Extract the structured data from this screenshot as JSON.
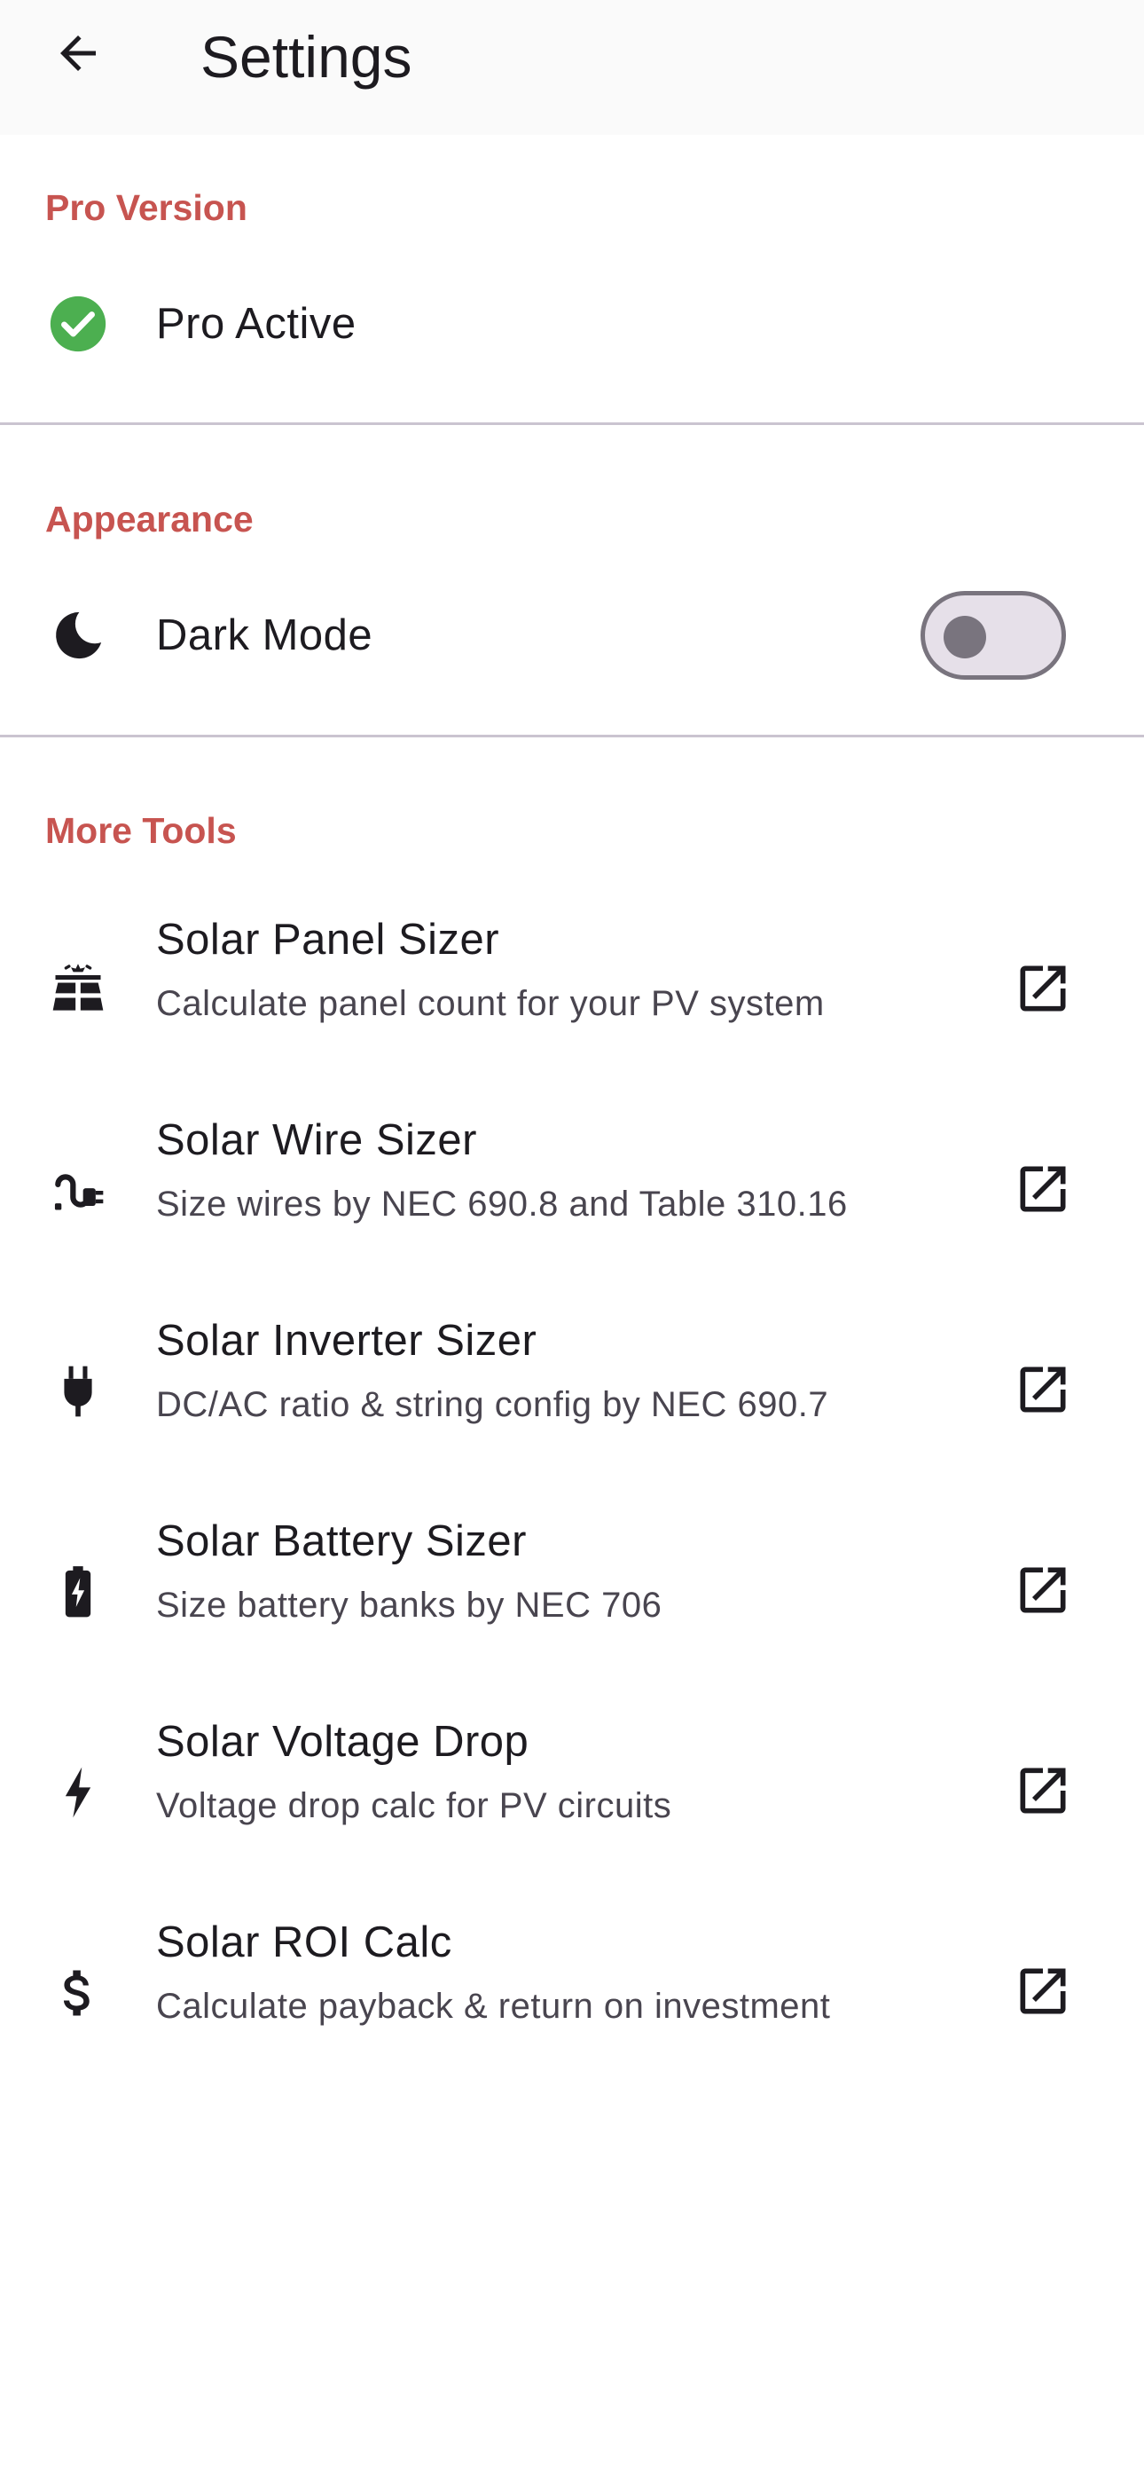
{
  "app_bar": {
    "title": "Settings"
  },
  "sections": {
    "pro": {
      "header": "Pro Version",
      "item_label": "Pro Active"
    },
    "appearance": {
      "header": "Appearance",
      "item_label": "Dark Mode",
      "toggle_on": false
    },
    "tools": {
      "header": "More Tools",
      "items": [
        {
          "title": "Solar Panel Sizer",
          "subtitle": "Calculate panel count for your PV system",
          "icon": "solar-panel-icon"
        },
        {
          "title": "Solar Wire Sizer",
          "subtitle": "Size wires by NEC 690.8 and Table 310.16",
          "icon": "cable-plug-icon"
        },
        {
          "title": "Solar Inverter Sizer",
          "subtitle": "DC/AC ratio & string config by NEC 690.7",
          "icon": "power-plug-icon"
        },
        {
          "title": "Solar Battery Sizer",
          "subtitle": "Size battery banks by NEC 706",
          "icon": "battery-charging-icon"
        },
        {
          "title": "Solar Voltage Drop",
          "subtitle": "Voltage drop calc for PV circuits",
          "icon": "bolt-icon"
        },
        {
          "title": "Solar ROI Calc",
          "subtitle": "Calculate payback & return on investment",
          "icon": "dollar-icon"
        }
      ]
    }
  },
  "colors": {
    "section_header": "#c75450",
    "check_green": "#4caf50",
    "icon_dark": "#1d1b20"
  }
}
